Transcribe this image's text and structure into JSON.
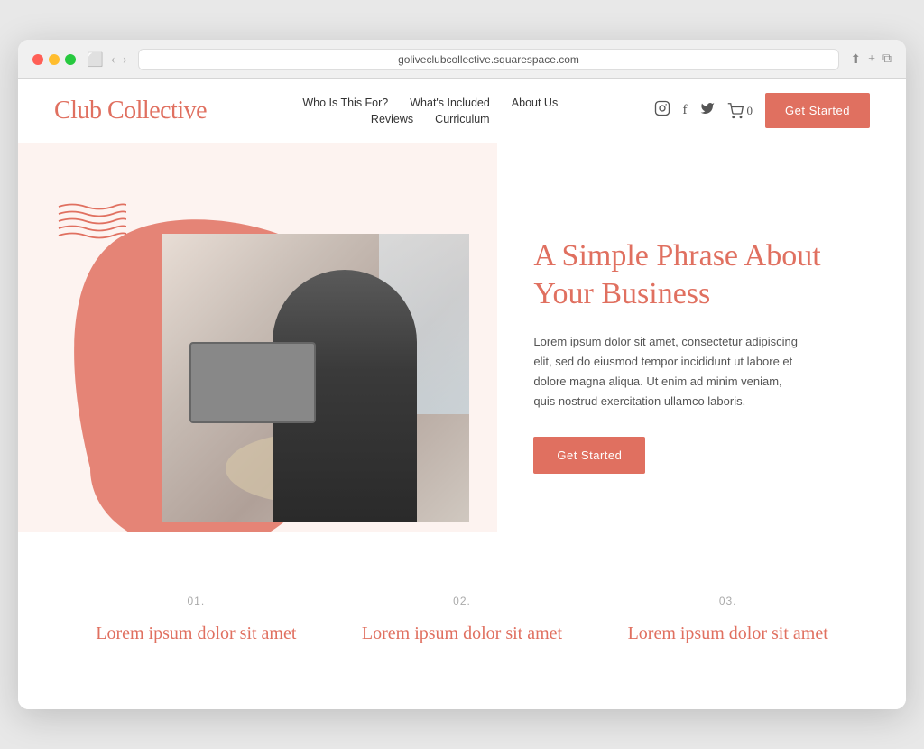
{
  "browser": {
    "url": "goliveclubcollective.squarespace.com",
    "reload_icon": "↻"
  },
  "header": {
    "logo": "Club Collective",
    "nav": {
      "row1": [
        {
          "label": "Who Is This For?",
          "id": "who"
        },
        {
          "label": "What's Included",
          "id": "whats"
        },
        {
          "label": "About Us",
          "id": "about"
        }
      ],
      "row2": [
        {
          "label": "Reviews",
          "id": "reviews"
        },
        {
          "label": "Curriculum",
          "id": "curriculum"
        }
      ]
    },
    "cart_count": "0",
    "get_started": "Get Started"
  },
  "hero": {
    "headline": "A Simple Phrase About Your Business",
    "body": "Lorem ipsum dolor sit amet, consectetur adipiscing elit, sed do eiusmod tempor incididunt ut labore et dolore magna aliqua. Ut enim ad minim veniam, quis nostrud exercitation ullamco laboris.",
    "cta": "Get Started"
  },
  "features": [
    {
      "number": "01.",
      "title": "Lorem ipsum dolor sit amet"
    },
    {
      "number": "02.",
      "title": "Lorem ipsum dolor sit amet"
    },
    {
      "number": "03.",
      "title": "Lorem ipsum dolor sit amet"
    }
  ],
  "colors": {
    "coral": "#e07060",
    "light_bg": "#fdf3f0",
    "text_dark": "#333333",
    "text_muted": "#555555"
  },
  "icons": {
    "instagram": "📷",
    "facebook": "f",
    "twitter": "t",
    "cart": "🛒"
  }
}
